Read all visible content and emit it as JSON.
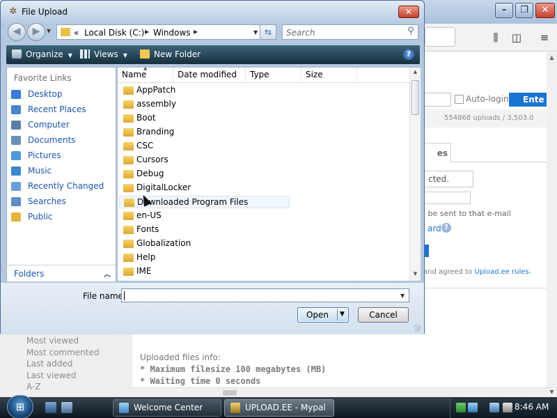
{
  "dialog": {
    "title": "File Upload",
    "address": {
      "overflow": "«",
      "crumbs": [
        "Local Disk (C:)",
        "Windows"
      ]
    },
    "search_placeholder": "Search",
    "toolbar": {
      "organize": "Organize",
      "views": "Views",
      "new_folder": "New Folder"
    },
    "favorite_links": {
      "heading": "Favorite Links",
      "items": [
        {
          "label": "Desktop",
          "icon": "desktop-icon",
          "color": "#3a7bd5"
        },
        {
          "label": "Recent Places",
          "icon": "recent-places-icon",
          "color": "#4a86c9"
        },
        {
          "label": "Computer",
          "icon": "computer-icon",
          "color": "#5c7fa8"
        },
        {
          "label": "Documents",
          "icon": "documents-icon",
          "color": "#6b8fb8"
        },
        {
          "label": "Pictures",
          "icon": "pictures-icon",
          "color": "#4f9ad6"
        },
        {
          "label": "Music",
          "icon": "music-icon",
          "color": "#3c86cc"
        },
        {
          "label": "Recently Changed",
          "icon": "recently-changed-icon",
          "color": "#6aa0d8"
        },
        {
          "label": "Searches",
          "icon": "searches-icon",
          "color": "#5a8ec4"
        },
        {
          "label": "Public",
          "icon": "public-folder-icon",
          "color": "#e2b53e"
        }
      ],
      "folders_label": "Folders"
    },
    "columns": [
      "Name",
      "Date modified",
      "Type",
      "Size"
    ],
    "files": [
      "AppPatch",
      "assembly",
      "Boot",
      "Branding",
      "CSC",
      "Cursors",
      "Debug",
      "DigitalLocker",
      "Downloaded Program Files",
      "en-US",
      "Fonts",
      "Globalization",
      "Help",
      "IME"
    ],
    "hovered_file": "Downloaded Program Files",
    "file_name_label": "File name:",
    "file_name_value": "",
    "open_label": "Open",
    "cancel_label": "Cancel"
  },
  "browser": {
    "autologin_label": "Auto-login",
    "enter_label": "Ente",
    "stats": "554868 uploads  /  3,503.0",
    "tab_label": "es",
    "select_value": "cted.",
    "email_note": "l be sent to that e-mail",
    "link_fragment": "ard",
    "agreed_text": "and agreed to ",
    "rules_link": "Upload.ee rules.",
    "left_menu": [
      "Most viewed",
      "Most commented",
      "Last added",
      "Last viewed",
      "A-Z"
    ],
    "upload_info": {
      "heading": "Uploaded files info:",
      "lines": [
        "* Maximum filesize 100 megabytes (MB)",
        "* Waiting time 0 seconds"
      ]
    }
  },
  "taskbar": {
    "tasks": [
      "Welcome Center",
      "UPLOAD.EE - Mypal"
    ],
    "active_task": "UPLOAD.EE - Mypal",
    "clock": "8:46 AM"
  },
  "colors": {
    "link_blue": "#1a55b0",
    "accent_blue": "#1a74d2",
    "folder_yellow": "#e8c04c"
  }
}
